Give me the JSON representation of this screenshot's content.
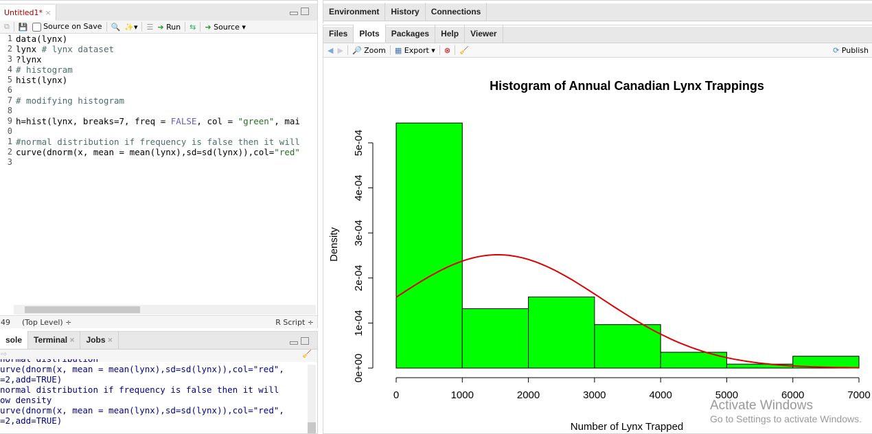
{
  "editor": {
    "tab": "Untitled1*",
    "source_on_save": "Source on Save",
    "run": "Run",
    "source": "Source",
    "lines": [
      {
        "n": "1",
        "parts": [
          [
            "",
            "data(lynx)"
          ]
        ]
      },
      {
        "n": "2",
        "parts": [
          [
            "",
            "lynx "
          ],
          [
            "cm",
            "# lynx dataset"
          ]
        ]
      },
      {
        "n": "3",
        "parts": [
          [
            "",
            "?lynx"
          ]
        ]
      },
      {
        "n": "4",
        "parts": [
          [
            "cm",
            "# histogram"
          ]
        ]
      },
      {
        "n": "5",
        "parts": [
          [
            "",
            "hist(lynx)"
          ]
        ]
      },
      {
        "n": "6",
        "parts": []
      },
      {
        "n": "7",
        "parts": [
          [
            "cm",
            "# modifying histogram"
          ]
        ]
      },
      {
        "n": "8",
        "parts": []
      },
      {
        "n": "9",
        "parts": [
          [
            "",
            "h=hist(lynx, breaks=7, freq = "
          ],
          [
            "kw",
            "FALSE"
          ],
          [
            "",
            ", col = "
          ],
          [
            "st",
            "\"green\""
          ],
          [
            "",
            ", mai"
          ]
        ]
      },
      {
        "n": "0",
        "parts": []
      },
      {
        "n": "1",
        "parts": [
          [
            "cm",
            "#normal distribution if frequency is false then it will"
          ]
        ]
      },
      {
        "n": "2",
        "parts": [
          [
            "",
            "curve(dnorm(x, mean = mean(lynx),sd=sd(lynx)),col="
          ],
          [
            "st",
            "\"red\""
          ]
        ]
      },
      {
        "n": "3",
        "parts": []
      }
    ],
    "status_pos": "49",
    "status_scope": "(Top Level) ÷",
    "status_type": "R Script ÷"
  },
  "console": {
    "tabs": [
      "sole",
      "Terminal",
      "Jobs"
    ],
    "lines": [
      "normal distribution",
      "urve(dnorm(x, mean = mean(lynx),sd=sd(lynx)),col=\"red\",",
      "=2,add=TRUE)",
      "normal distribution if frequency is false then it will",
      "ow density",
      "urve(dnorm(x, mean = mean(lynx),sd=sd(lynx)),col=\"red\",",
      "=2,add=TRUE)"
    ]
  },
  "env_tabs": [
    "Environment",
    "History",
    "Connections"
  ],
  "files_tabs": [
    "Files",
    "Plots",
    "Packages",
    "Help",
    "Viewer"
  ],
  "plot_toolbar": {
    "zoom": "Zoom",
    "export": "Export",
    "publish": "Publish"
  },
  "watermark": {
    "line1": "Activate Windows",
    "line2": "Go to Settings to activate Windows."
  },
  "colors": {
    "bar": "#00ff00",
    "curve": "#dd0000"
  },
  "chart_data": {
    "type": "bar",
    "title": "Histogram of Annual Canadian Lynx Trappings",
    "xlabel": "Number of Lynx Trapped",
    "ylabel": "Density",
    "breaks": [
      0,
      1000,
      2000,
      3000,
      4000,
      5000,
      6000,
      7000
    ],
    "values": [
      0.000544,
      0.000132,
      0.000158,
      9.65e-05,
      3.51e-05,
      8.8e-06,
      2.63e-05
    ],
    "xticks": [
      "0",
      "1000",
      "2000",
      "3000",
      "4000",
      "5000",
      "6000",
      "7000"
    ],
    "yticks": [
      {
        "v": 0,
        "label": "0e+00"
      },
      {
        "v": 0.0001,
        "label": "1e-04"
      },
      {
        "v": 0.0002,
        "label": "2e-04"
      },
      {
        "v": 0.0003,
        "label": "3e-04"
      },
      {
        "v": 0.0004,
        "label": "4e-04"
      },
      {
        "v": 0.0005,
        "label": "5e-04"
      }
    ],
    "curve": {
      "dist": "normal",
      "mean": 1538,
      "sd": 1586
    },
    "xlim": [
      0,
      7000
    ],
    "ylim": [
      0,
      0.000544
    ]
  }
}
